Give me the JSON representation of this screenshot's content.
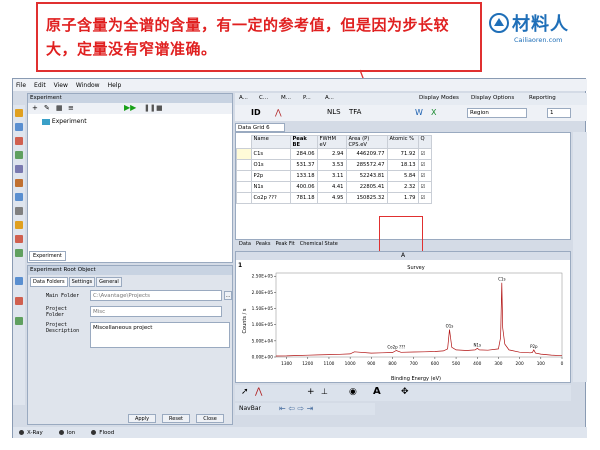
{
  "banner": {
    "text": "原子含量为全谱的含量，有一定的参考值，但是因为步长较大，定量没有窄谱准确。"
  },
  "logo": {
    "name": "材料人",
    "domain": "Cailiaoren.com",
    "brand_color": "#1f6fb8"
  },
  "menubar": [
    "File",
    "Edit",
    "View",
    "Window",
    "Help"
  ],
  "experiment_panel": {
    "title": "Experiment",
    "tree_item": "Experiment",
    "tab": "Experiment"
  },
  "root_panel": {
    "title": "Experiment Root Object",
    "tabs": [
      "Data Folders",
      "Settings",
      "General"
    ],
    "main_folder_label": "Main Folder",
    "main_folder_value": "C:\\Avantage\\Projects",
    "project_folder_label": "Project Folder",
    "project_folder_value": "Misc",
    "project_desc_label": "Project Description",
    "project_desc_value": "Miscellaneous project",
    "buttons": {
      "apply": "Apply",
      "reset": "Reset",
      "close": "Close"
    }
  },
  "right_toolbar": {
    "items": [
      "A...",
      "C...",
      "M...",
      "P...",
      "A...",
      "Display Modes",
      "Display Options",
      "Reporting"
    ],
    "region_label": "Region",
    "spin_value": "1"
  },
  "grid": {
    "tab": "Data Grid 6",
    "columns": [
      "Name",
      "Peak BE",
      "FWHM eV",
      "Area (P) CPS.eV",
      "Atomic %",
      "Q"
    ],
    "rows": [
      {
        "name": "C1s",
        "be": "284.06",
        "fwhm": "2.94",
        "area": "446209.77",
        "atomic": "71.92"
      },
      {
        "name": "O1s",
        "be": "531.37",
        "fwhm": "3.53",
        "area": "285572.47",
        "atomic": "18.13"
      },
      {
        "name": "P2p",
        "be": "133.18",
        "fwhm": "3.11",
        "area": "52243.81",
        "atomic": "5.84"
      },
      {
        "name": "N1s",
        "be": "400.06",
        "fwhm": "4.41",
        "area": "22805.41",
        "atomic": "2.32"
      },
      {
        "name": "Co2p ???",
        "be": "781.18",
        "fwhm": "4.95",
        "area": "150825.32",
        "atomic": "1.79"
      }
    ],
    "bottom_tabs": [
      "Data",
      "Peaks",
      "Peak Fit",
      "Chemical State"
    ]
  },
  "chart_panel": {
    "header": "A",
    "index": "1"
  },
  "chart_data": {
    "type": "line",
    "title": "Survey",
    "xlabel": "Binding Energy (eV)",
    "ylabel": "Counts / s",
    "x_ticks": [
      1300,
      1200,
      1100,
      1000,
      900,
      800,
      700,
      600,
      500,
      400,
      300,
      200,
      100,
      0
    ],
    "y_ticks": [
      "0.00E+00",
      "5.00E+04",
      "1.00E+05",
      "1.50E+05",
      "2.00E+05",
      "2.50E+05"
    ],
    "xlim": [
      1350,
      0
    ],
    "ylim": [
      0,
      260000
    ],
    "series": [
      {
        "x": [
          1350,
          1300,
          1250,
          1200,
          1150,
          1100,
          1050,
          1000,
          980,
          900,
          850,
          800,
          782,
          760,
          700,
          650,
          600,
          560,
          540,
          531,
          520,
          500,
          450,
          410,
          400,
          390,
          350,
          300,
          290,
          284,
          280,
          270,
          250,
          200,
          150,
          140,
          133,
          125,
          100,
          50,
          0
        ],
        "y": [
          3000,
          3500,
          4500,
          5500,
          6500,
          7500,
          8500,
          9500,
          16000,
          12000,
          13000,
          14000,
          20000,
          14500,
          15500,
          16000,
          17000,
          19000,
          25000,
          85000,
          30000,
          22000,
          20000,
          22000,
          27000,
          22000,
          21000,
          25000,
          60000,
          230000,
          90000,
          40000,
          22000,
          15000,
          13000,
          14000,
          22000,
          12000,
          9000,
          6000,
          4000
        ]
      }
    ],
    "annotations": [
      {
        "label": "O1s",
        "x": 531
      },
      {
        "label": "C1s",
        "x": 284
      },
      {
        "label": "Co2p ???",
        "x": 782
      },
      {
        "label": "N1s",
        "x": 400
      },
      {
        "label": "P2p",
        "x": 133
      }
    ],
    "line_color": "#b01010"
  },
  "navbar": {
    "label": "NavBar"
  },
  "statusbar": [
    {
      "label": "X-Ray",
      "color": "#333333"
    },
    {
      "label": "Ion",
      "color": "#333333"
    },
    {
      "label": "Flood",
      "color": "#333333"
    }
  ]
}
